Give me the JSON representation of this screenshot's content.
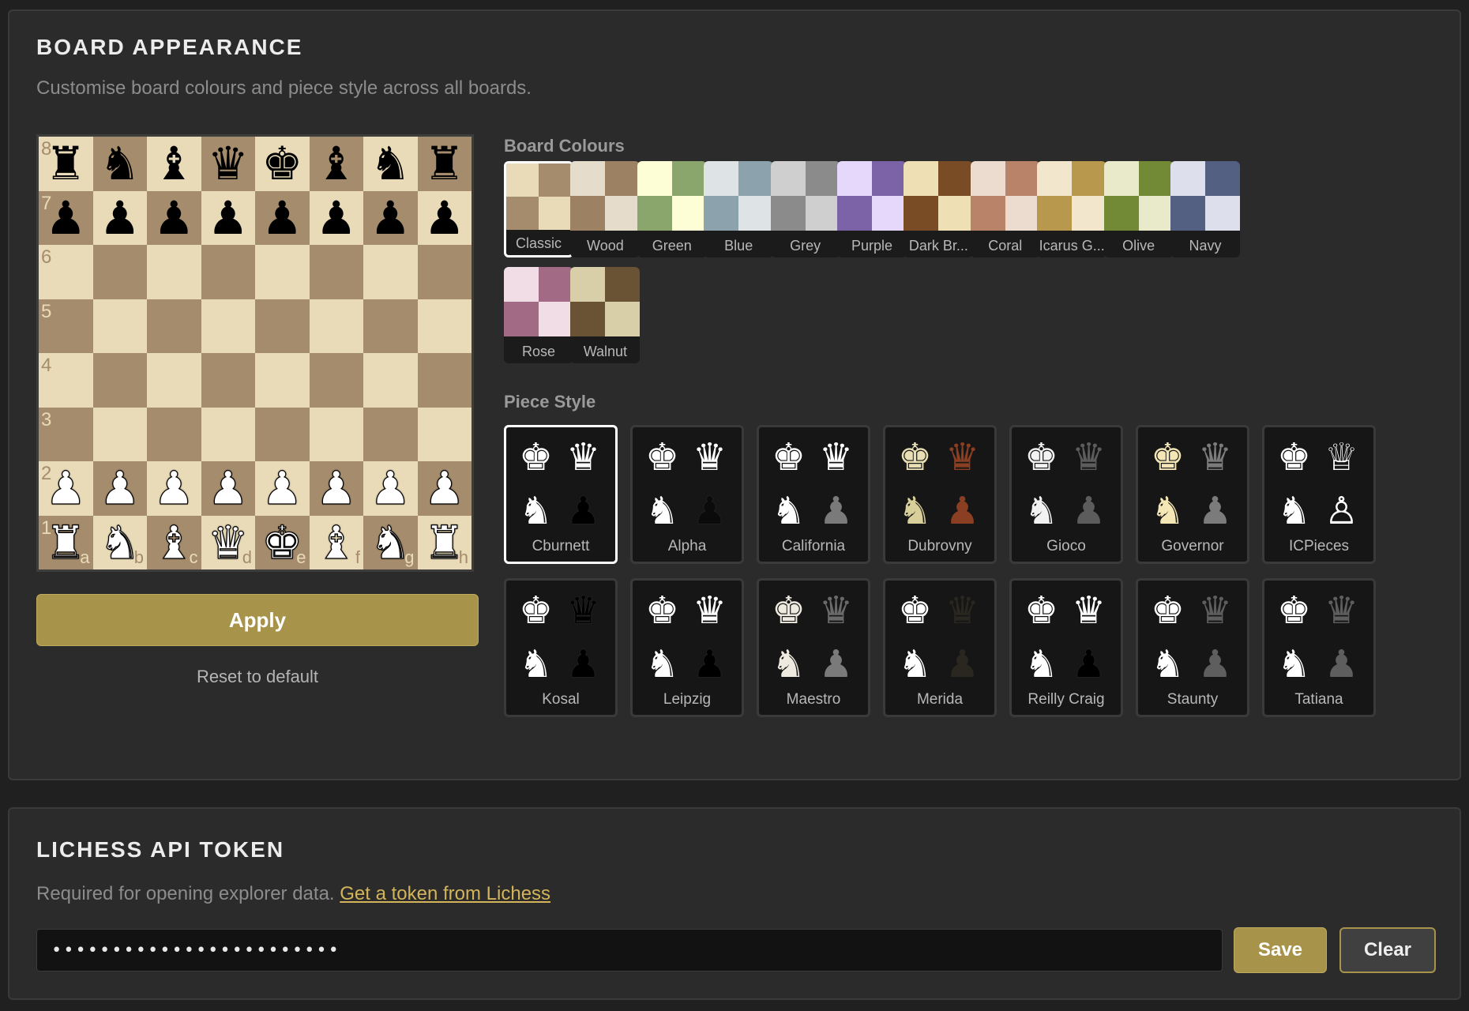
{
  "board_section": {
    "title": "BOARD APPEARANCE",
    "description": "Customise board colours and piece style across all boards."
  },
  "board": {
    "light_color": "#e9dbb7",
    "dark_color": "#a58c6c",
    "ranks": [
      "8",
      "7",
      "6",
      "5",
      "4",
      "3",
      "2",
      "1"
    ],
    "files": [
      "a",
      "b",
      "c",
      "d",
      "e",
      "f",
      "g",
      "h"
    ],
    "rows": [
      [
        "bR",
        "bN",
        "bB",
        "bQ",
        "bK",
        "bB",
        "bN",
        "bR"
      ],
      [
        "bP",
        "bP",
        "bP",
        "bP",
        "bP",
        "bP",
        "bP",
        "bP"
      ],
      [
        "",
        "",
        "",
        "",
        "",
        "",
        "",
        ""
      ],
      [
        "",
        "",
        "",
        "",
        "",
        "",
        "",
        ""
      ],
      [
        "",
        "",
        "",
        "",
        "",
        "",
        "",
        ""
      ],
      [
        "",
        "",
        "",
        "",
        "",
        "",
        "",
        ""
      ],
      [
        "wP",
        "wP",
        "wP",
        "wP",
        "wP",
        "wP",
        "wP",
        "wP"
      ],
      [
        "wR",
        "wN",
        "wB",
        "wQ",
        "wK",
        "wB",
        "wN",
        "wR"
      ]
    ]
  },
  "actions": {
    "apply_label": "Apply",
    "reset_label": "Reset to default"
  },
  "board_colours": {
    "heading": "Board Colours",
    "selected": "Classic",
    "items": [
      {
        "label": "Classic",
        "light": "#e9dbb7",
        "dark": "#a58c6c"
      },
      {
        "label": "Wood",
        "light": "#e6dccb",
        "dark": "#9c8262"
      },
      {
        "label": "Green",
        "light": "#fefed6",
        "dark": "#8aa66c"
      },
      {
        "label": "Blue",
        "light": "#dee3e6",
        "dark": "#8ca2ad"
      },
      {
        "label": "Grey",
        "light": "#cfcfcf",
        "dark": "#8b8b8b"
      },
      {
        "label": "Purple",
        "light": "#e5d8fa",
        "dark": "#7c63a8"
      },
      {
        "label": "Dark Br...",
        "light": "#efdfb5",
        "dark": "#7a4c25"
      },
      {
        "label": "Coral",
        "light": "#ecdcd0",
        "dark": "#b88369"
      },
      {
        "label": "Icarus G...",
        "light": "#f2e6cd",
        "dark": "#b8984d"
      },
      {
        "label": "Olive",
        "light": "#e8eac9",
        "dark": "#728a36"
      },
      {
        "label": "Navy",
        "light": "#dde0ec",
        "dark": "#536081"
      },
      {
        "label": "Rose",
        "light": "#f1dde6",
        "dark": "#a36a85"
      },
      {
        "label": "Walnut",
        "light": "#d8cfa8",
        "dark": "#6a5234"
      }
    ]
  },
  "piece_style": {
    "heading": "Piece Style",
    "selected": "Cburnett",
    "items": [
      {
        "label": "Cburnett",
        "glyphs": [
          "♚",
          "♛",
          "♞",
          "♟"
        ],
        "colors": [
          "#ffffff",
          "#ffffff",
          "#ffffff",
          "#000000"
        ]
      },
      {
        "label": "Alpha",
        "glyphs": [
          "♚",
          "♛",
          "♞",
          "♟"
        ],
        "colors": [
          "#ffffff",
          "#ffffff",
          "#ffffff",
          "#0b0b0b"
        ]
      },
      {
        "label": "California",
        "glyphs": [
          "♚",
          "♛",
          "♞",
          "♟"
        ],
        "colors": [
          "#ffffff",
          "#ffffff",
          "#ffffff",
          "#7a7a7a"
        ]
      },
      {
        "label": "Dubrovny",
        "glyphs": [
          "♚",
          "♛",
          "♞",
          "♟"
        ],
        "colors": [
          "#e8dfb5",
          "#8a3e22",
          "#d8cf9a",
          "#8a3e22"
        ]
      },
      {
        "label": "Gioco",
        "glyphs": [
          "♚",
          "♛",
          "♞",
          "♟"
        ],
        "colors": [
          "#f2f2f2",
          "#5c5c5c",
          "#f2f2f2",
          "#5c5c5c"
        ]
      },
      {
        "label": "Governor",
        "glyphs": [
          "♚",
          "♛",
          "♞",
          "♟"
        ],
        "colors": [
          "#f4e6b5",
          "#7b7b7b",
          "#f4e6b5",
          "#7b7b7b"
        ]
      },
      {
        "label": "ICPieces",
        "glyphs": [
          "♚",
          "♕",
          "♞",
          "♙"
        ],
        "colors": [
          "#ffffff",
          "#ffffff",
          "#ffffff",
          "#ffffff"
        ]
      },
      {
        "label": "Kosal",
        "glyphs": [
          "♚",
          "♛",
          "♞",
          "♟"
        ],
        "colors": [
          "#ffffff",
          "#000000",
          "#ffffff",
          "#000000"
        ]
      },
      {
        "label": "Leipzig",
        "glyphs": [
          "♚",
          "♛",
          "♞",
          "♟"
        ],
        "colors": [
          "#ffffff",
          "#ffffff",
          "#ffffff",
          "#000000"
        ]
      },
      {
        "label": "Maestro",
        "glyphs": [
          "♚",
          "♛",
          "♞",
          "♟"
        ],
        "colors": [
          "#efeadf",
          "#6a6a6a",
          "#efeadf",
          "#7a7a7a"
        ]
      },
      {
        "label": "Merida",
        "glyphs": [
          "♚",
          "♛",
          "♞",
          "♟"
        ],
        "colors": [
          "#ffffff",
          "#2a2620",
          "#ffffff",
          "#2a2620"
        ]
      },
      {
        "label": "Reilly Craig",
        "glyphs": [
          "♚",
          "♛",
          "♞",
          "♟"
        ],
        "colors": [
          "#ffffff",
          "#ffffff",
          "#ffffff",
          "#000000"
        ]
      },
      {
        "label": "Staunty",
        "glyphs": [
          "♚",
          "♛",
          "♞",
          "♟"
        ],
        "colors": [
          "#ffffff",
          "#5e5e5e",
          "#ffffff",
          "#5e5e5e"
        ]
      },
      {
        "label": "Tatiana",
        "glyphs": [
          "♚",
          "♛",
          "♞",
          "♟"
        ],
        "colors": [
          "#ffffff",
          "#5e5e5e",
          "#ffffff",
          "#5e5e5e"
        ]
      }
    ]
  },
  "token_section": {
    "title": "LICHESS API TOKEN",
    "description": "Required for opening explorer data.",
    "link_text": "Get a token from Lichess",
    "input_value": "••••••••••••••••••••••••",
    "save_label": "Save",
    "clear_label": "Clear"
  },
  "colors": {
    "accent": "#a8934a",
    "link": "#d4b45a",
    "background": "#202020",
    "panel": "#2b2b2b"
  }
}
